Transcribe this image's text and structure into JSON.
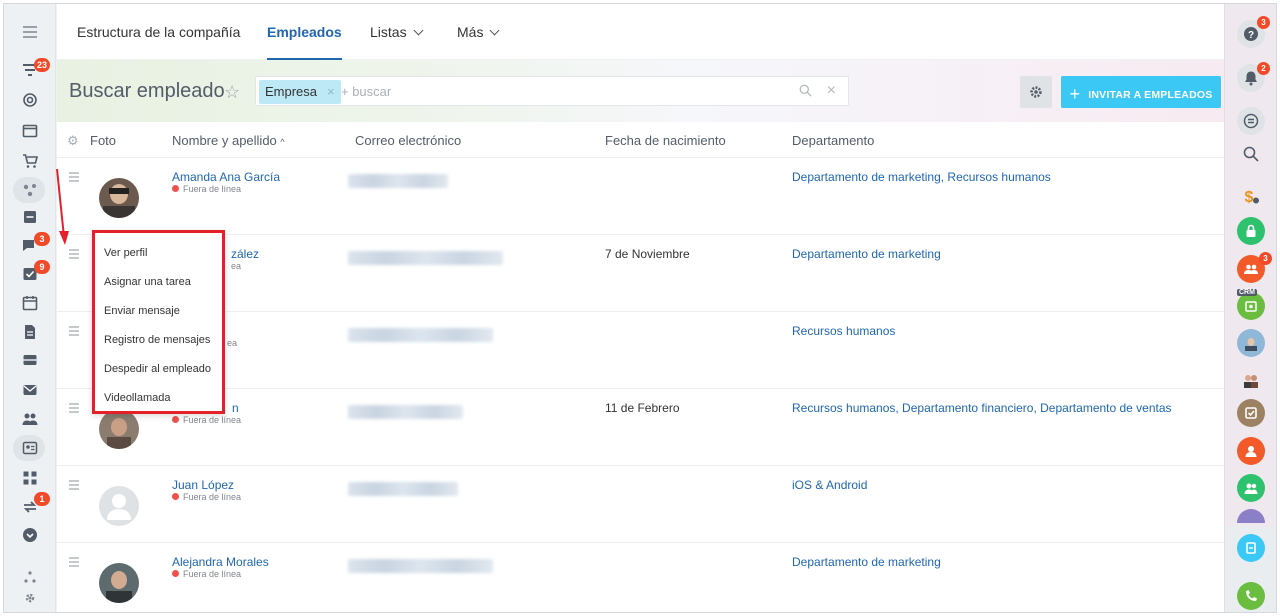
{
  "nav": {
    "tabs": [
      {
        "label": "Estructura de la compañía"
      },
      {
        "label": "Empleados"
      },
      {
        "label": "Listas"
      },
      {
        "label": "Más"
      }
    ]
  },
  "header": {
    "title": "Buscar empleado",
    "filter_chip": "Empresa",
    "search_placeholder": "+ buscar",
    "invite_label": "INVITAR A EMPLEADOS"
  },
  "table": {
    "columns": [
      "Foto",
      "Nombre y apellido",
      "Correo electrónico",
      "Fecha de nacimiento",
      "Departamento"
    ],
    "rows": [
      {
        "name": "Amanda Ana García",
        "status": "Fuera de línea",
        "birthday": "",
        "department": "Departamento de marketing, Recursos humanos"
      },
      {
        "name": "zález",
        "status": "ea",
        "birthday": "7 de Noviembre",
        "department": "Departamento de marketing"
      },
      {
        "name": "",
        "status": "ea",
        "birthday": "",
        "department": "Recursos humanos"
      },
      {
        "name": "n",
        "status": "Fuera de línea",
        "birthday": "11 de Febrero",
        "department": "Recursos humanos, Departamento financiero, Departamento de ventas"
      },
      {
        "name": "Juan López",
        "status": "Fuera de línea",
        "birthday": "",
        "department": "iOS & Android"
      },
      {
        "name": "Alejandra Morales",
        "status": "Fuera de línea",
        "birthday": "",
        "department": "Departamento de marketing"
      }
    ]
  },
  "context_menu": {
    "items": [
      "Ver perfil",
      "Asignar una tarea",
      "Enviar mensaje",
      "Registro de mensajes",
      "Despedir al empleado",
      "Videollamada"
    ]
  },
  "left_sidebar": {
    "badges": {
      "filters": "23",
      "chat": "3",
      "tasks": "9",
      "sync": "1"
    }
  },
  "right_sidebar": {
    "badges": {
      "help": "3",
      "notifications": "2",
      "group": "3"
    },
    "crm_label": "CRM"
  },
  "colors": {
    "accent": "#2067b0",
    "invite": "#3bc8f5",
    "highlight": "#e4202b",
    "offline": "#f0504c"
  }
}
